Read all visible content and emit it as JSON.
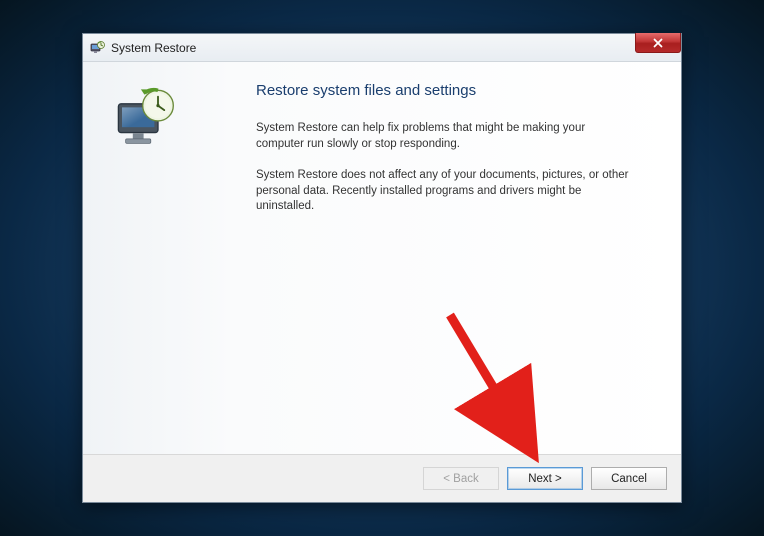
{
  "window": {
    "title": "System Restore"
  },
  "content": {
    "heading": "Restore system files and settings",
    "para1": "System Restore can help fix problems that might be making your computer run slowly or stop responding.",
    "para2": "System Restore does not affect any of your documents, pictures, or other personal data. Recently installed programs and drivers might be uninstalled."
  },
  "buttons": {
    "back": "< Back",
    "next": "Next >",
    "cancel": "Cancel"
  }
}
